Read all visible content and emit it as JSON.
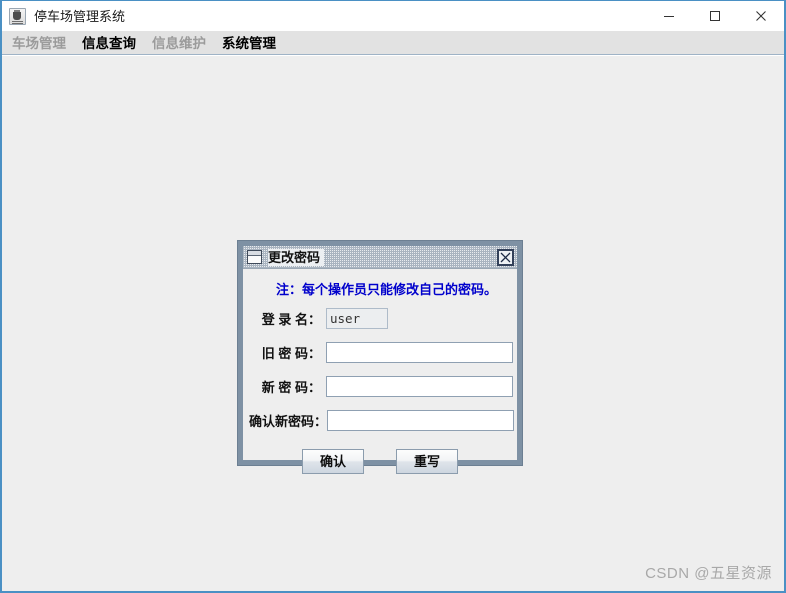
{
  "window": {
    "title": "停车场管理系统",
    "icon": "java-coffee-cup-icon",
    "controls": {
      "minimize": "minimize-icon",
      "maximize": "maximize-icon",
      "close": "close-icon"
    }
  },
  "menubar": {
    "items": [
      {
        "label": "车场管理",
        "enabled": false
      },
      {
        "label": "信息查询",
        "enabled": true
      },
      {
        "label": "信息维护",
        "enabled": false
      },
      {
        "label": "系统管理",
        "enabled": true
      }
    ]
  },
  "dialog": {
    "title": "更改密码",
    "icon": "window-frame-icon",
    "close_icon": "close-x-icon",
    "notice": "注：每个操作员只能修改自己的密码。",
    "fields": [
      {
        "label": "登 录 名：",
        "value": "user",
        "placeholder": "",
        "readonly": true,
        "name": "login-name-field"
      },
      {
        "label": "旧 密 码：",
        "value": "",
        "placeholder": "",
        "readonly": false,
        "name": "old-password-field"
      },
      {
        "label": "新 密 码：",
        "value": "",
        "placeholder": "",
        "readonly": false,
        "name": "new-password-field"
      },
      {
        "label": "确认新密码：",
        "value": "",
        "placeholder": "",
        "readonly": false,
        "name": "confirm-password-field"
      }
    ],
    "buttons": {
      "confirm": "确认",
      "reset": "重写"
    }
  },
  "watermark": "CSDN @五星资源",
  "colors": {
    "accent_border": "#4a90c4",
    "notice_text": "#0000cc",
    "dialog_border": "#7e91a4",
    "desktop_bg": "#eeeeee",
    "menubar_bg": "#e2e2e2",
    "disabled_text": "#9b9b9b"
  }
}
